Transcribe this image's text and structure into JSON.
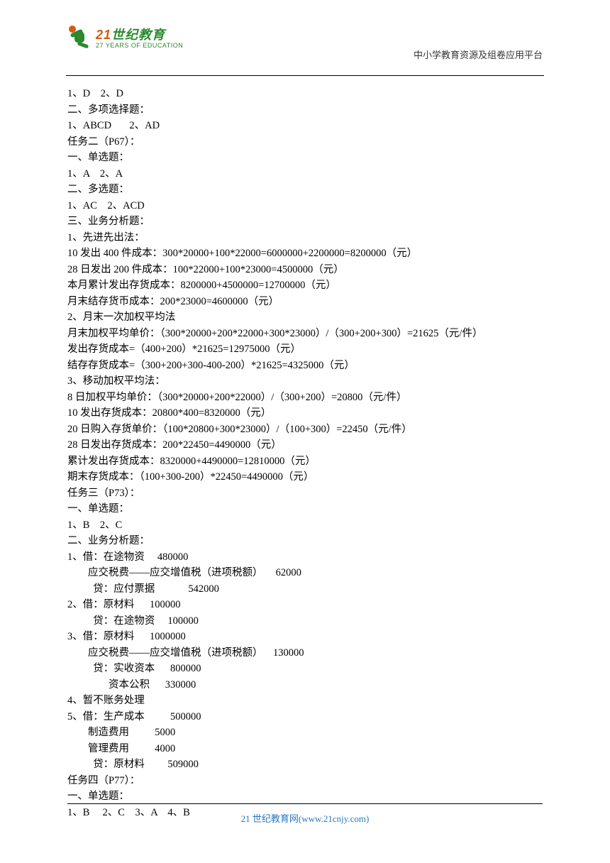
{
  "header": {
    "brand_num": "21",
    "brand_cn": "世纪教育",
    "brand_sub": "27 YEARS OF EDUCATION",
    "right_text": "中小学教育资源及组卷应用平台"
  },
  "lines": [
    "1、D    2、D",
    "二、多项选择题：",
    "1、ABCD       2、AD",
    "任务二（P67）：",
    "一、单选题：",
    "1、A    2、A",
    "二、多选题：",
    "1、AC    2、ACD",
    "三、业务分析题：",
    "1、先进先出法：",
    "10 发出 400 件成本：300*20000+100*22000=6000000+2200000=8200000（元）",
    "28 日发出 200 件成本：100*22000+100*23000=4500000（元）",
    "本月累计发出存货成本：8200000+4500000=12700000（元）",
    "月末结存货币成本：200*23000=4600000（元）",
    "2、月末一次加权平均法",
    "月末加权平均单价：（300*20000+200*22000+300*23000）/（300+200+300）=21625（元/件）",
    "发出存货成本=（400+200）*21625=12975000（元）",
    "结存存货成本=（300+200+300-400-200）*21625=4325000（元）",
    "3、移动加权平均法：",
    "8 日加权平均单价：（300*20000+200*22000）/（300+200）=20800（元/件）",
    "10 发出存货成本：20800*400=8320000（元）",
    "20 日购入存货单价：（100*20800+300*23000）/（100+300）=22450（元/件）",
    "28 日发出存货成本：200*22450=4490000（元）",
    "累计发出存货成本：8320000+4490000=12810000（元）",
    "期末存货成本：（100+300-200）*22450=4490000（元）",
    "任务三（P73）：",
    "一、单选题：",
    "1、B    2、C",
    "二、业务分析题：",
    "1、借：在途物资     480000",
    "        应交税费——应交增值税（进项税额）     62000",
    "          贷：应付票据             542000",
    "2、借：原材料      100000",
    "          贷：在途物资     100000",
    "3、借：原材料      1000000",
    "        应交税费——应交增值税（进项税额）    130000",
    "          贷：实收资本      800000",
    "                资本公积      330000",
    "4、暂不账务处理",
    "5、借：生产成本          500000",
    "        制造费用          5000",
    "        管理费用          4000",
    "          贷：原材料         509000",
    "任务四（P77）：",
    "一、单选题：",
    "1、B     2、C    3、A    4、B"
  ],
  "footer": {
    "text": "21 世纪教育网(www.21cnjy.com)"
  }
}
